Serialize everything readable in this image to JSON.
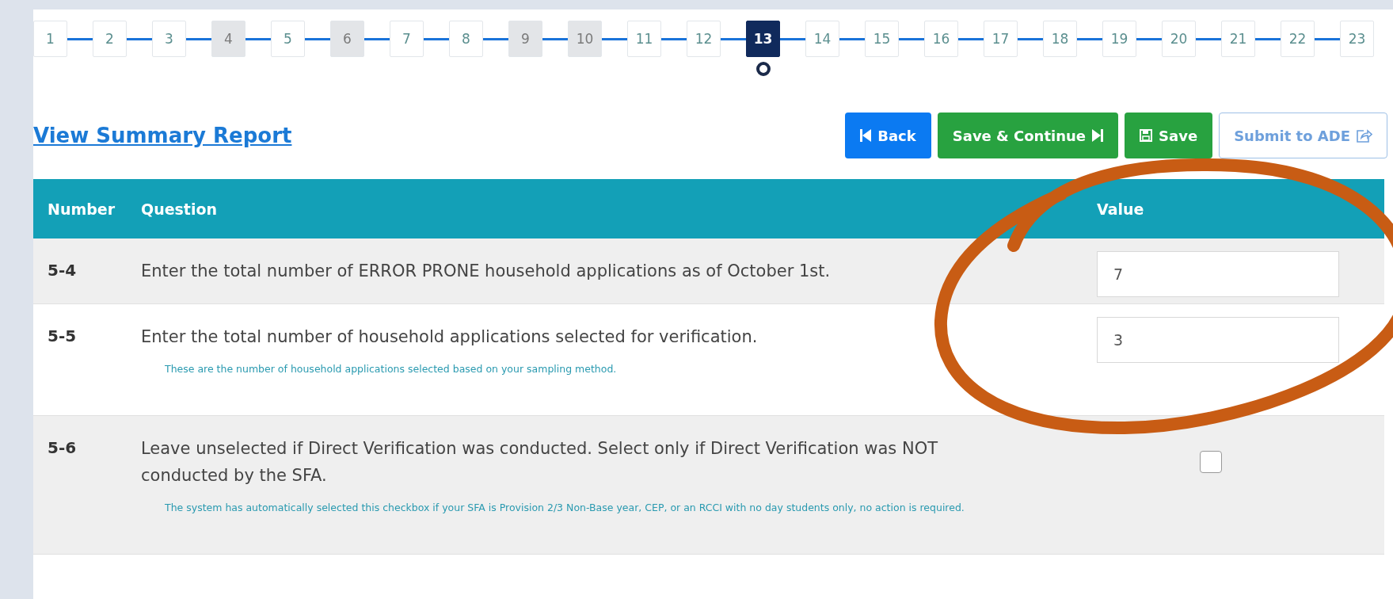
{
  "steps": [
    {
      "label": "1",
      "selected": false,
      "disabled": false
    },
    {
      "label": "2",
      "selected": false,
      "disabled": false
    },
    {
      "label": "3",
      "selected": false,
      "disabled": false
    },
    {
      "label": "4",
      "selected": false,
      "disabled": true
    },
    {
      "label": "5",
      "selected": false,
      "disabled": false
    },
    {
      "label": "6",
      "selected": false,
      "disabled": true
    },
    {
      "label": "7",
      "selected": false,
      "disabled": false
    },
    {
      "label": "8",
      "selected": false,
      "disabled": false
    },
    {
      "label": "9",
      "selected": false,
      "disabled": true
    },
    {
      "label": "10",
      "selected": false,
      "disabled": true
    },
    {
      "label": "11",
      "selected": false,
      "disabled": false
    },
    {
      "label": "12",
      "selected": false,
      "disabled": false
    },
    {
      "label": "13",
      "selected": true,
      "disabled": false
    },
    {
      "label": "14",
      "selected": false,
      "disabled": false
    },
    {
      "label": "15",
      "selected": false,
      "disabled": false
    },
    {
      "label": "16",
      "selected": false,
      "disabled": false
    },
    {
      "label": "17",
      "selected": false,
      "disabled": false
    },
    {
      "label": "18",
      "selected": false,
      "disabled": false
    },
    {
      "label": "19",
      "selected": false,
      "disabled": false
    },
    {
      "label": "20",
      "selected": false,
      "disabled": false
    },
    {
      "label": "21",
      "selected": false,
      "disabled": false
    },
    {
      "label": "22",
      "selected": false,
      "disabled": false
    },
    {
      "label": "23",
      "selected": false,
      "disabled": false
    }
  ],
  "summary_link": "View Summary Report",
  "buttons": [
    {
      "label": "Back",
      "kind": "back"
    },
    {
      "label": "Save & Continue",
      "kind": "continue"
    },
    {
      "label": "Save",
      "kind": "save"
    },
    {
      "label": "Submit to ADE",
      "kind": "submit"
    }
  ],
  "table": {
    "columns": [
      "Number",
      "Question",
      "Value"
    ],
    "rows": [
      {
        "number": "5-4",
        "question": "Enter the total number of ERROR PRONE household applications as of October 1st.",
        "kind": "text",
        "value": "7"
      },
      {
        "number": "5-5",
        "question": "Enter the total number of household applications selected for verification.",
        "hint": "These are the number of household applications selected based on your sampling method.",
        "kind": "text",
        "value": "3"
      },
      {
        "number": "5-6",
        "question": "Leave unselected if Direct Verification was conducted. Select only if Direct Verification was NOT conducted by the SFA.",
        "hint": "The system has automatically selected this checkbox if your SFA is Provision 2/3 Non-Base year, CEP, or an RCCI with no day students only, no action is required.",
        "kind": "checkbox",
        "checked": false
      }
    ]
  }
}
